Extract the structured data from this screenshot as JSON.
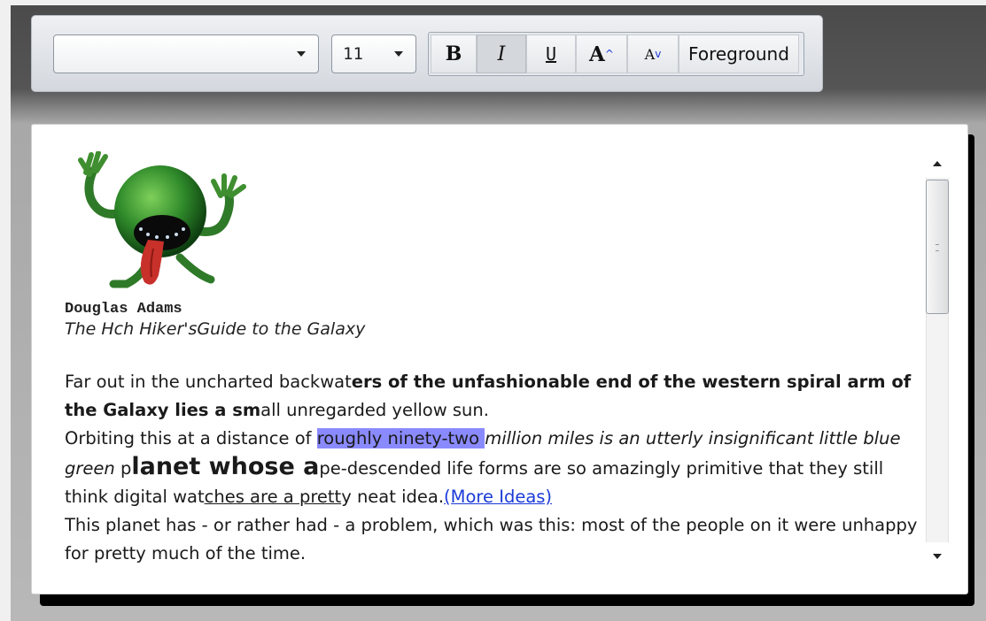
{
  "toolbar": {
    "font_family_value": "",
    "font_size_value": "11",
    "bold_label": "B",
    "italic_label": "I",
    "underline_label": "U",
    "grow_label": "A",
    "grow_caret": "^",
    "shrink_label": "A",
    "shrink_caret": "v",
    "foreground_label": "Foreground"
  },
  "document": {
    "author": "Douglas Adams",
    "book_title": "The Hch Hiker'sGuide to the Galaxy",
    "p1_a": "Far out in the uncharted backwat",
    "p1_b": "ers of the unfashionable end of the western spiral arm of the Galaxy lies a sm",
    "p1_c": "all unregarded yellow sun.",
    "p2_a": "Orbiting this at a distance of ",
    "p2_hl": "roughly ninety-two ",
    "p2_i": "million miles is an utterly insignificant little blue green ",
    "p2_p": "p",
    "p2_big": "lanet whose a",
    "p2_c": "pe-descended life forms are so amazingly primitive that they still think digital wat",
    "p2_u": "ches are a prett",
    "p2_d": "y neat idea.",
    "p2_link": "(More Ideas)",
    "p3": "This planet has - or rather had - a problem, which was this: most of the people on it were unhappy for pretty much of the time."
  },
  "colors": {
    "highlight": "#8a8aff",
    "link": "#1a3ad8",
    "mascot_green": "#2f8a2a"
  }
}
